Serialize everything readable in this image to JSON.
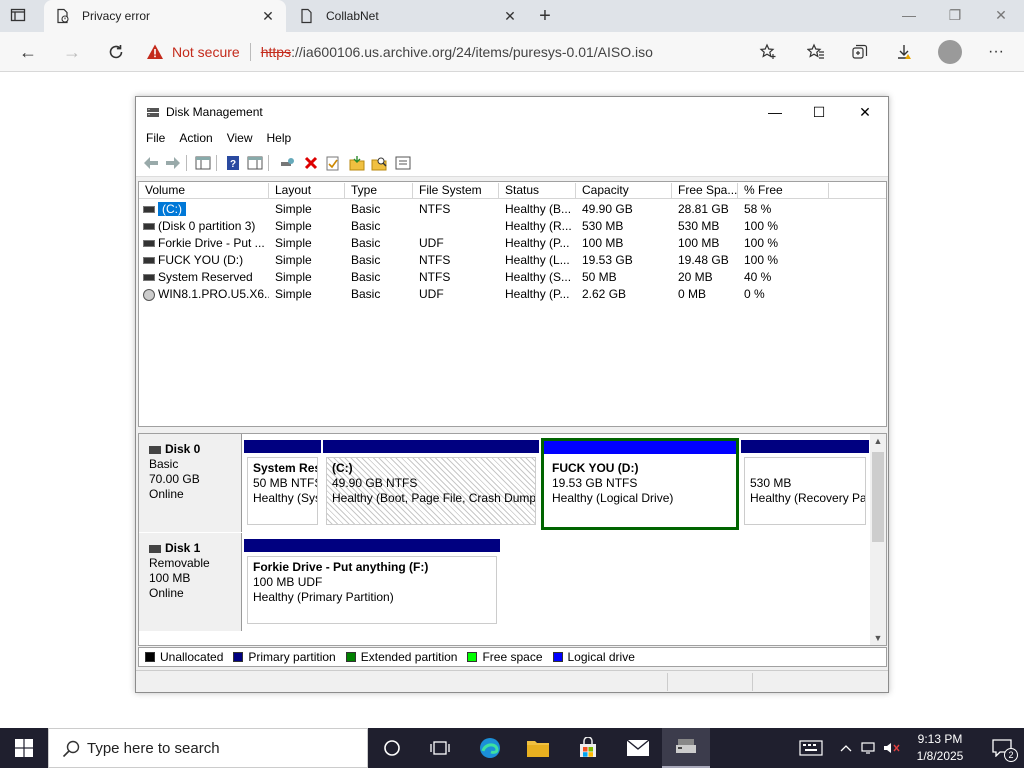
{
  "browser": {
    "tabs": [
      {
        "title": "Privacy error",
        "close": "✕"
      },
      {
        "title": "CollabNet",
        "close": "✕"
      }
    ],
    "new_tab": "+",
    "url_warning": "Not secure",
    "url_scheme": "https",
    "url_rest": "://ia600106.us.archive.org/24/items/puresys-0.01/AISO.iso",
    "window_controls": {
      "minimize": "—",
      "maximize": "❐",
      "close": "✕"
    }
  },
  "dm": {
    "title": "Disk Management",
    "controls": {
      "minimize": "—",
      "maximize": "☐",
      "close": "✕"
    },
    "menu": [
      "File",
      "Action",
      "View",
      "Help"
    ],
    "columns": [
      "Volume",
      "Layout",
      "Type",
      "File System",
      "Status",
      "Capacity",
      "Free Spa...",
      "% Free"
    ],
    "volumes": [
      {
        "volume": "(C:)",
        "layout": "Simple",
        "type": "Basic",
        "fs": "NTFS",
        "status": "Healthy (B...",
        "capacity": "49.90 GB",
        "free": "28.81 GB",
        "pct": "58 %"
      },
      {
        "volume": "(Disk 0 partition 3)",
        "layout": "Simple",
        "type": "Basic",
        "fs": "",
        "status": "Healthy (R...",
        "capacity": "530 MB",
        "free": "530 MB",
        "pct": "100 %"
      },
      {
        "volume": "Forkie Drive - Put ...",
        "layout": "Simple",
        "type": "Basic",
        "fs": "UDF",
        "status": "Healthy (P...",
        "capacity": "100 MB",
        "free": "100 MB",
        "pct": "100 %"
      },
      {
        "volume": "FUCK YOU (D:)",
        "layout": "Simple",
        "type": "Basic",
        "fs": "NTFS",
        "status": "Healthy (L...",
        "capacity": "19.53 GB",
        "free": "19.48 GB",
        "pct": "100 %"
      },
      {
        "volume": "System Reserved",
        "layout": "Simple",
        "type": "Basic",
        "fs": "NTFS",
        "status": "Healthy (S...",
        "capacity": "50 MB",
        "free": "20 MB",
        "pct": "40 %"
      },
      {
        "volume": "WIN8.1.PRO.U5.X6...",
        "layout": "Simple",
        "type": "Basic",
        "fs": "UDF",
        "status": "Healthy (P...",
        "capacity": "2.62 GB",
        "free": "0 MB",
        "pct": "0 %"
      }
    ],
    "disks": [
      {
        "name": "Disk 0",
        "kind": "Basic",
        "size": "70.00 GB",
        "state": "Online",
        "partitions": [
          {
            "name": "System Res",
            "size": "50 MB NTFS",
            "status": "Healthy (Sys"
          },
          {
            "name": "(C:)",
            "size": "49.90 GB NTFS",
            "status": "Healthy (Boot, Page File, Crash Dump,"
          },
          {
            "name": "FUCK YOU  (D:)",
            "size": "19.53 GB NTFS",
            "status": "Healthy (Logical Drive)"
          },
          {
            "name": "",
            "size": "530 MB",
            "status": "Healthy (Recovery Pa"
          }
        ]
      },
      {
        "name": "Disk 1",
        "kind": "Removable",
        "size": "100 MB",
        "state": "Online",
        "partitions": [
          {
            "name": "Forkie Drive - Put anything  (F:)",
            "size": "100 MB UDF",
            "status": "Healthy (Primary Partition)"
          }
        ]
      }
    ],
    "legend": [
      {
        "label": "Unallocated",
        "color": "#000000"
      },
      {
        "label": "Primary partition",
        "color": "#000080"
      },
      {
        "label": "Extended partition",
        "color": "#008000"
      },
      {
        "label": "Free space",
        "color": "#00ff00"
      },
      {
        "label": "Logical drive",
        "color": "#0000ff"
      }
    ]
  },
  "taskbar": {
    "search_placeholder": "Type here to search",
    "time": "9:13 PM",
    "date": "1/8/2025",
    "notifications": "2"
  }
}
